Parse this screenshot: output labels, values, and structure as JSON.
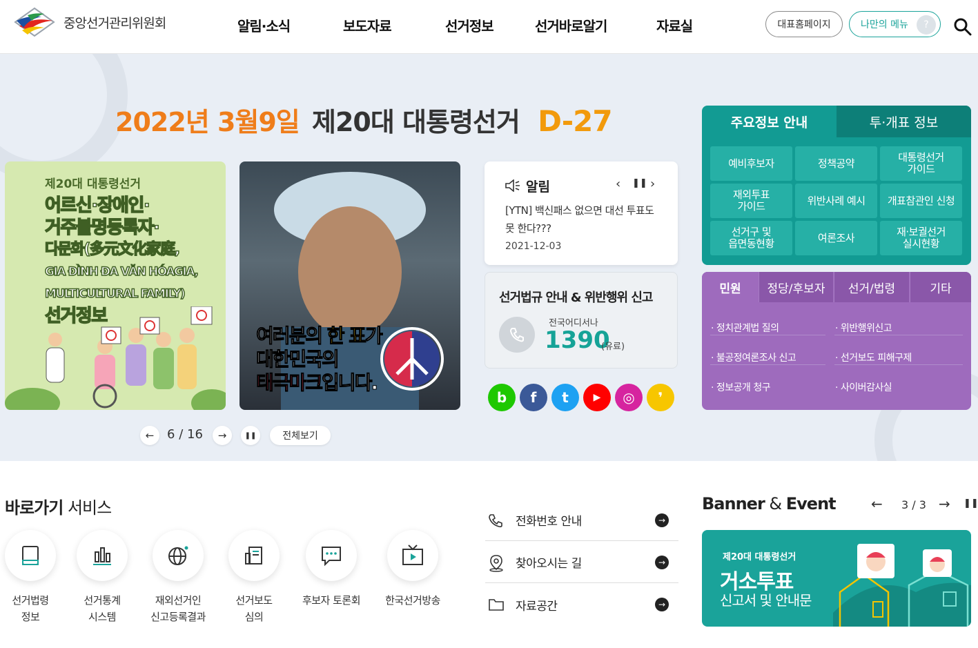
{
  "header": {
    "org_name": "중앙선거관리위원회",
    "nav": [
      "알림·소식",
      "보도자료",
      "선거정보",
      "선거바로알기",
      "자료실"
    ],
    "main_site_btn": "대표홈페이지",
    "my_menu_btn": "나만의 메뉴",
    "help_glyph": "?"
  },
  "hero": {
    "dday_date": "2022년 3월9일",
    "dday_title": "제20대 대통령선거",
    "dday_count": "D-27",
    "slide1": {
      "kicker": "제20대 대통령선거",
      "lines": [
        "어르신·장애인·",
        "거주불명등록자·",
        "다문화(多元文化家庭,",
        "GIA ĐÌNH ĐA VĂN HÓAGIA,",
        "MULTICULTURAL FAMILY)",
        "선거정보"
      ]
    },
    "slide2": {
      "line1_a": "여러분의 ",
      "line1_b": "한 표",
      "line1_c": "가",
      "line2": "대한민국의",
      "line3_a": "태극마크",
      "line3_b": "입니다."
    },
    "pager": {
      "current": "6",
      "sep": "/",
      "total": "16",
      "view_all": "전체보기"
    },
    "notice": {
      "title": "알림",
      "text": "[YTN] 백신패스 없으면 대선 투표도 못 한다???",
      "date": "2021-12-03"
    },
    "report": {
      "title": "선거법규 안내 & 위반행위 신고",
      "sub": "전국어디서나",
      "number": "1390",
      "fee": "(유료)"
    },
    "sns": [
      {
        "icon": "blog-icon",
        "glyph": "b",
        "color": "#1ec800"
      },
      {
        "icon": "facebook-icon",
        "glyph": "f",
        "color": "#3b5998"
      },
      {
        "icon": "twitter-icon",
        "glyph": "t",
        "color": "#1da1f2"
      },
      {
        "icon": "youtube-icon",
        "glyph": "▶",
        "color": "#ff0000"
      },
      {
        "icon": "instagram-icon",
        "glyph": "◎",
        "color": "#d6249f"
      },
      {
        "icon": "kakao-icon",
        "glyph": "❜",
        "color": "#f7c600"
      }
    ]
  },
  "info_tabs": {
    "tab1": "주요정보 안내",
    "tab2": "투·개표 정보",
    "items": [
      "예비후보자",
      "정책공약",
      "대통령선거\n가이드",
      "재외투표\n가이드",
      "위반사례 예시",
      "개표참관인 신청",
      "선거구 및\n읍면동현황",
      "여론조사",
      "재·보궐선거\n실시현황"
    ]
  },
  "civil": {
    "tabs": [
      "민원",
      "정당/후보자",
      "선거/법령",
      "기타"
    ],
    "links": [
      "정치관계법 질의",
      "위반행위신고",
      "불공정여론조사 신고",
      "선거보도 피해구제",
      "정보공개 청구",
      "사이버감사실"
    ]
  },
  "quick": {
    "title_bold": "바로가기",
    "title_rest": " 서비스",
    "items": [
      {
        "label": "선거법령\n정보",
        "icon": "book-icon"
      },
      {
        "label": "선거통계\n시스템",
        "icon": "bar-chart-icon"
      },
      {
        "label": "재외선거인\n신고등록결과",
        "icon": "globe-icon"
      },
      {
        "label": "선거보도\n심의",
        "icon": "news-icon"
      },
      {
        "label": "후보자 토론회",
        "icon": "chat-bubble-icon"
      },
      {
        "label": "한국선거방송",
        "icon": "tv-play-icon"
      }
    ]
  },
  "info_links": [
    "전화번호 안내",
    "찾아오시는 길",
    "자료공간"
  ],
  "banner": {
    "title_a": "Banner",
    "title_b": " & ",
    "title_c": "Event",
    "current": "3",
    "sep": "/",
    "total": "3",
    "kicker": "제20대 대통령선거",
    "headline": "거소투표",
    "sub": "신고서 및 안내문"
  }
}
